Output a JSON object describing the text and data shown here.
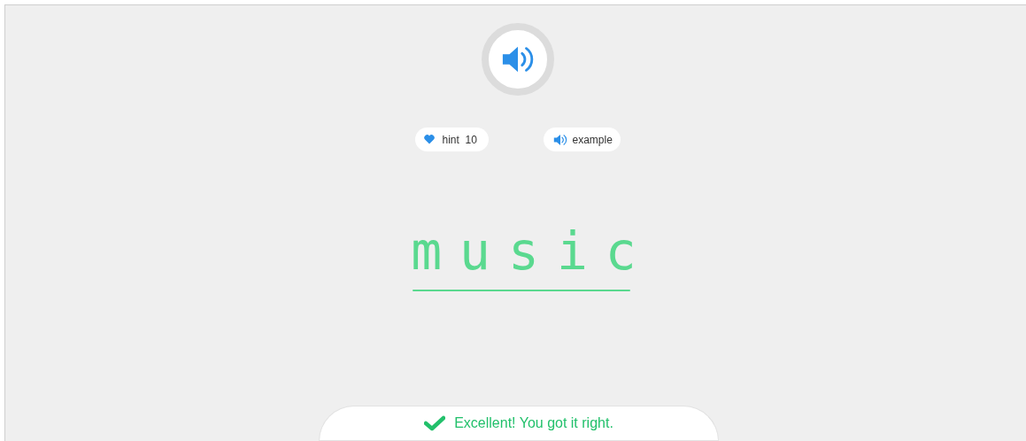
{
  "hint": {
    "label": "hint",
    "count": "10"
  },
  "example": {
    "label": "example"
  },
  "answer": {
    "word": "music",
    "correct": true
  },
  "feedback": {
    "correct": true,
    "message": "Excellent! You got it right."
  }
}
